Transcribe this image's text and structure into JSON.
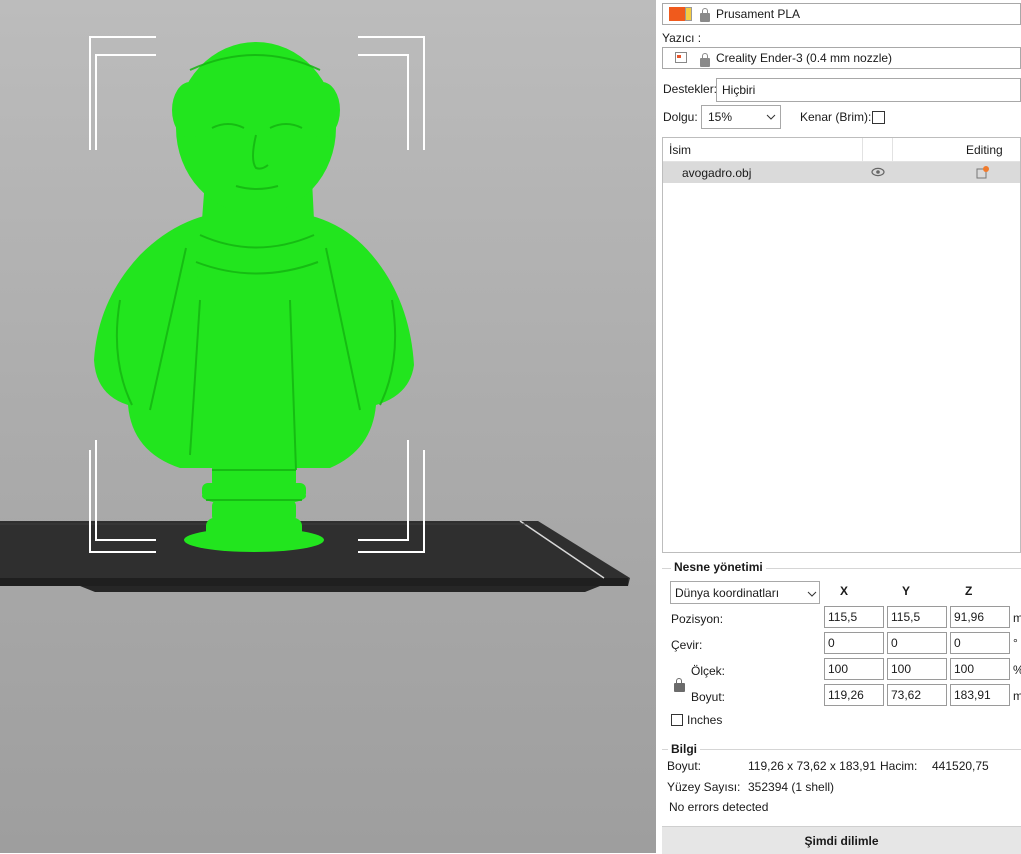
{
  "viewport": {
    "model_color": "#22e51e",
    "bed_color": "#333333"
  },
  "filament": {
    "value": "Prusament PLA",
    "swatch_colors": [
      "#f05a1c",
      "#f5cc42"
    ]
  },
  "printer": {
    "label": "Yazıcı :",
    "value": "Creality Ender-3 (0.4 mm nozzle)"
  },
  "supports": {
    "label": "Destekler:",
    "value": "Hiçbiri"
  },
  "infill": {
    "label": "Dolgu:",
    "value": "15%"
  },
  "brim": {
    "label": "Kenar (Brim):",
    "checked": false
  },
  "object_list": {
    "col_name": "İsim",
    "col_editing": "Editing",
    "items": [
      {
        "name": "avogadro.obj"
      }
    ]
  },
  "object_manipulation": {
    "title": "Nesne yönetimi",
    "coord_system": "Dünya koordinatları",
    "axes": [
      "X",
      "Y",
      "Z"
    ],
    "position": {
      "label": "Pozisyon:",
      "x": "115,5",
      "y": "115,5",
      "z": "91,96",
      "unit": "m"
    },
    "rotation": {
      "label": "Çevir:",
      "x": "0",
      "y": "0",
      "z": "0",
      "unit": "°"
    },
    "scale": {
      "label": "Ölçek:",
      "x": "100",
      "y": "100",
      "z": "100",
      "unit": "%"
    },
    "size": {
      "label": "Boyut:",
      "x": "119,26",
      "y": "73,62",
      "z": "183,91",
      "unit": "m"
    },
    "inches_label": "Inches"
  },
  "info": {
    "title": "Bilgi",
    "size_label": "Boyut:",
    "size_value": "119,26 x 73,62 x 183,91",
    "volume_label": "Hacim:",
    "volume_value": "441520,75",
    "facets_label": "Yüzey Sayısı:",
    "facets_value": "352394 (1 shell)",
    "errors": "No errors detected"
  },
  "slice_button": "Şimdi dilimle"
}
